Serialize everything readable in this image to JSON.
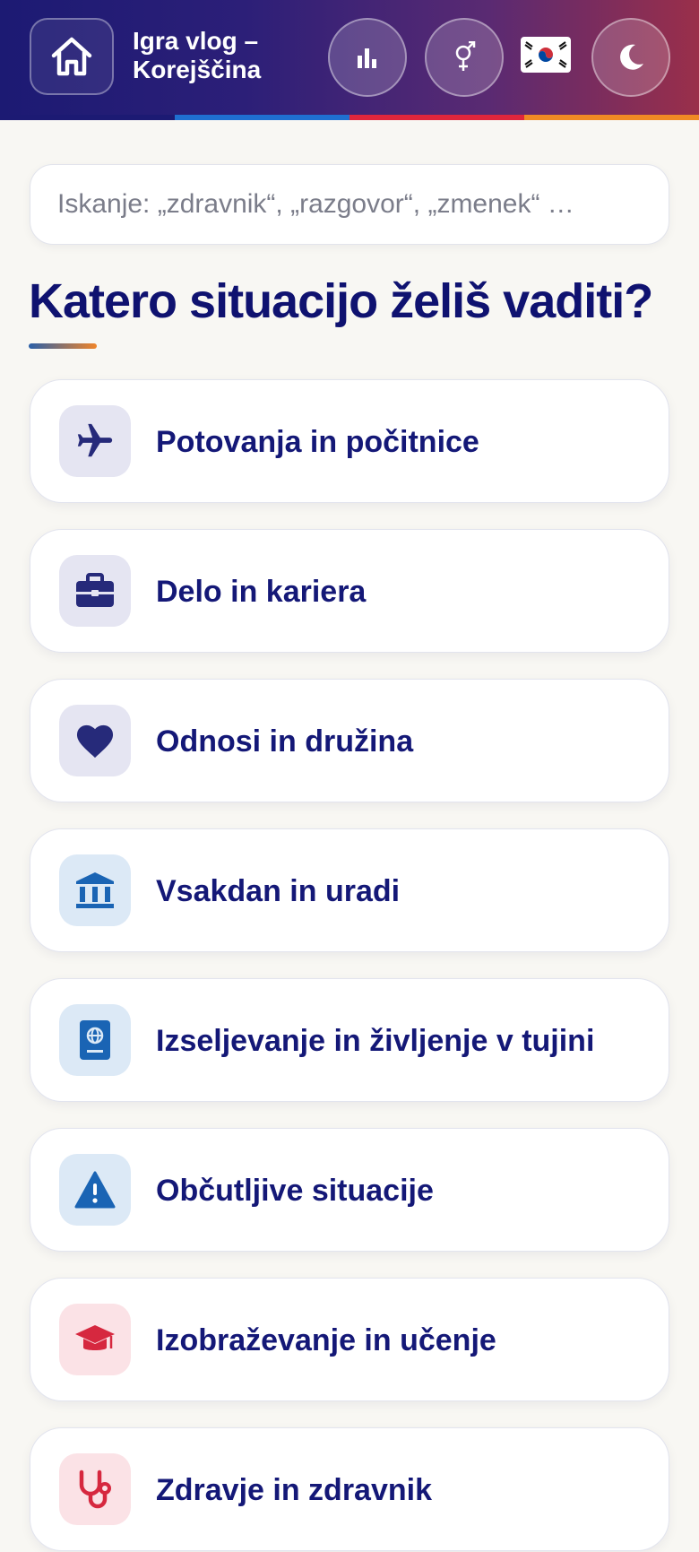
{
  "header": {
    "title": "Igra vlog – Korejščina",
    "icons": {
      "home": "home-icon",
      "stats": "bar-chart-icon",
      "gender": "gender-icon",
      "flag": "south-korea-flag-icon",
      "theme": "moon-icon"
    },
    "stripe_colors": [
      "#1c1a73",
      "#1f6fd1",
      "#e0263c",
      "#f08a24"
    ]
  },
  "search": {
    "placeholder": "Iskanje: „zdravnik“, „razgovor“, „zmenek“ …"
  },
  "page": {
    "title": "Katero situacijo želiš vaditi?"
  },
  "categories": [
    {
      "label": "Potovanja in počitnice",
      "icon": "airplane-icon",
      "icon_bg": "#e5e5f2",
      "icon_color": "#262a7a"
    },
    {
      "label": "Delo in kariera",
      "icon": "briefcase-icon",
      "icon_bg": "#e5e5f2",
      "icon_color": "#262a7a"
    },
    {
      "label": "Odnosi in družina",
      "icon": "heart-icon",
      "icon_bg": "#e5e5f2",
      "icon_color": "#262a7a"
    },
    {
      "label": "Vsakdan in uradi",
      "icon": "bank-icon",
      "icon_bg": "#dce9f6",
      "icon_color": "#1a64b4"
    },
    {
      "label": "Izseljevanje in življenje v tujini",
      "icon": "passport-icon",
      "icon_bg": "#dce9f6",
      "icon_color": "#1a64b4"
    },
    {
      "label": "Občutljive situacije",
      "icon": "warning-icon",
      "icon_bg": "#dce9f6",
      "icon_color": "#1a64b4"
    },
    {
      "label": "Izobraževanje in učenje",
      "icon": "graduation-cap-icon",
      "icon_bg": "#fbe2e6",
      "icon_color": "#d6283f"
    },
    {
      "label": "Zdravje in zdravnik",
      "icon": "stethoscope-icon",
      "icon_bg": "#fbe2e6",
      "icon_color": "#d6283f"
    }
  ]
}
